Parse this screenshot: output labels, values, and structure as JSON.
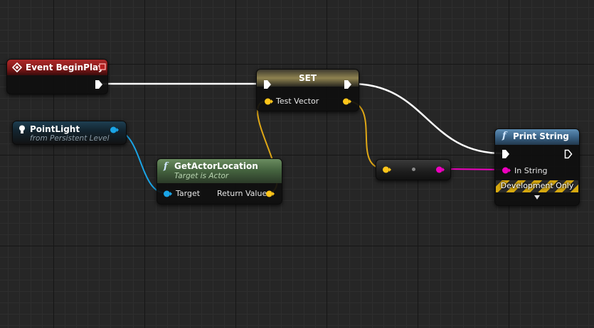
{
  "event_node": {
    "title": "Event BeginPlay"
  },
  "set_node": {
    "title": "SET",
    "variable": "Test Vector"
  },
  "pointlight_node": {
    "title": "PointLight",
    "subtitle": "from Persistent Level"
  },
  "getloc_node": {
    "title": "GetActorLocation",
    "subtitle": "Target is Actor",
    "input_label": "Target",
    "output_label": "Return Value"
  },
  "print_node": {
    "title": "Print String",
    "input_label": "In String",
    "dev_label": "Development Only"
  },
  "colors": {
    "exec_wire": "#ffffff",
    "vector_pin": "#ffc51a",
    "object_pin": "#1aa4e6",
    "string_pin": "#ee00bf",
    "event_header": "#8e1b1b",
    "function_header_green": "#4d6b45",
    "function_header_blue": "#35597a"
  }
}
